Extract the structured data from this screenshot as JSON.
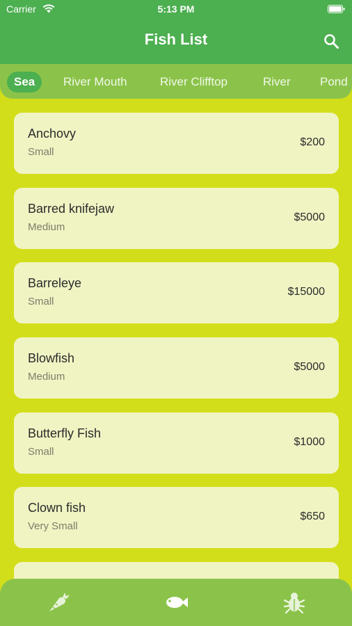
{
  "status_bar": {
    "carrier": "Carrier",
    "time": "5:13 PM"
  },
  "header": {
    "title": "Fish List",
    "search_icon": "search-icon"
  },
  "tabs": [
    {
      "label": "Sea",
      "active": true
    },
    {
      "label": "River Mouth",
      "active": false
    },
    {
      "label": "River Clifftop",
      "active": false
    },
    {
      "label": "River",
      "active": false
    },
    {
      "label": "Pond",
      "active": false
    }
  ],
  "fish": [
    {
      "name": "Anchovy",
      "size": "Small",
      "price": "$200"
    },
    {
      "name": "Barred knifejaw",
      "size": "Medium",
      "price": "$5000"
    },
    {
      "name": "Barreleye",
      "size": "Small",
      "price": "$15000"
    },
    {
      "name": "Blowfish",
      "size": "Medium",
      "price": "$5000"
    },
    {
      "name": "Butterfly Fish",
      "size": "Small",
      "price": "$1000"
    },
    {
      "name": "Clown fish",
      "size": "Very Small",
      "price": "$650"
    }
  ],
  "bottom_nav": [
    {
      "icon": "carrot-icon",
      "active": false
    },
    {
      "icon": "fish-icon",
      "active": true
    },
    {
      "icon": "bug-icon",
      "active": false
    }
  ],
  "colors": {
    "header": "#4caf50",
    "tab_bar": "#8bc34a",
    "background": "#d3de1a",
    "card": "#f0f4c3"
  }
}
